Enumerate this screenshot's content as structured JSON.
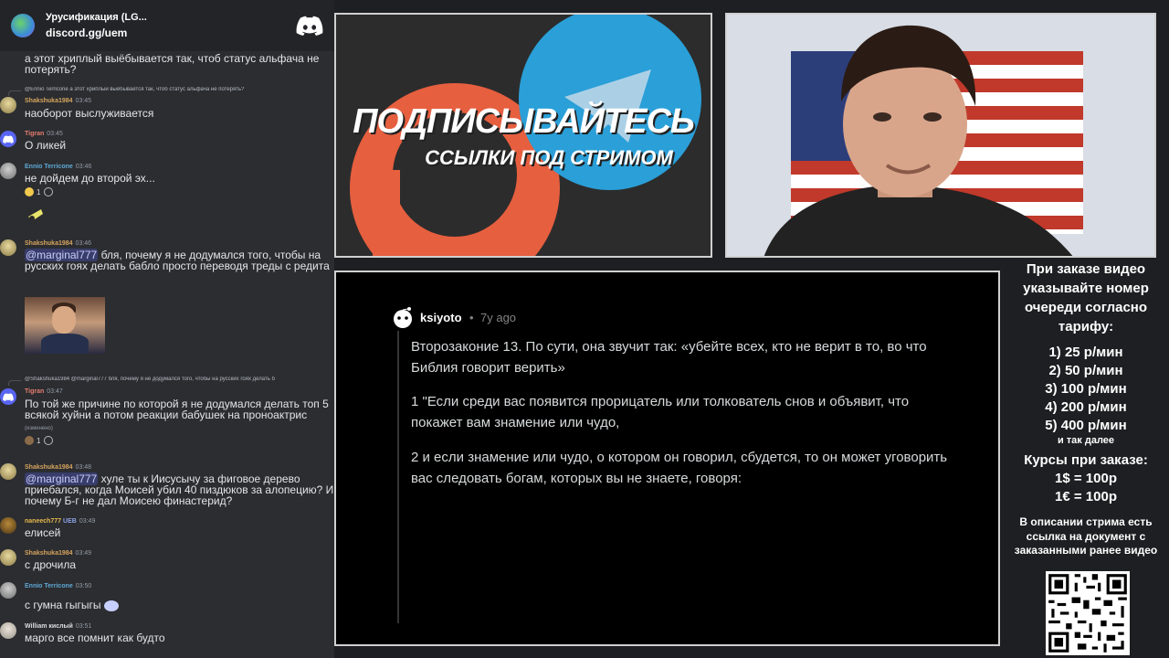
{
  "header": {
    "server_name": "Урусификация (LG...",
    "server_link": "discord.gg/uem"
  },
  "chat": {
    "top_text": "а этот хриплый выёбывается так, чтоб статус альфача не потерять?",
    "messages": [
      {
        "reply": "@Ennio Terricone  а этот хриплый выёбывается так, чтоб статус альфача не потерять?",
        "user": "Shakshuka1984",
        "time": "03:45",
        "text": "наоборот выслуживается"
      },
      {
        "user": "Tigran",
        "time": "03:45",
        "text": "О ликей"
      },
      {
        "user": "Ennio Terricone",
        "time": "03:46",
        "text": "не дойдем до второй эх...",
        "react_count": "1"
      },
      {
        "user": "Shakshuka1984",
        "time": "03:46",
        "mention": "@marginal777",
        "text": " бля, почему я не додумался того, чтобы на русских гоях делать бабло просто переводя треды с редита"
      },
      {
        "reply": "@Shakshuka1984  @marginal777  бля, почему я не додумался того, чтобы на русских гоях делать б",
        "user": "Tigran",
        "time": "03:47",
        "text": "По той же причине по которой я не додумался делать топ 5 всякой хуйни а потом  реакции бабушек на проноактрис",
        "edited": "(изменено)",
        "react_count": "1"
      },
      {
        "user": "Shakshuka1984",
        "time": "03:48",
        "mention": "@marginal777",
        "text": " хуле ты к Иисусычу за фиговое дерево приебался, когда Моисей убил 40 пиздюков за алопецию? И почему Б-г не дал Моисею финастерид?"
      },
      {
        "user": "naneech777",
        "tag": "UEB",
        "time": "03:49",
        "text": "елисей"
      },
      {
        "user": "Shakshuka1984",
        "time": "03:49",
        "text": "с дрочила"
      },
      {
        "user": "Ennio Terricone",
        "time": "03:50",
        "text": "с гумна гыгыгы"
      },
      {
        "user": "William кислый",
        "time": "03:51",
        "text": "марго все помнит как будто"
      }
    ]
  },
  "banner": {
    "line1": "ПОДПИСЫВАЙТЕСЬ",
    "line2": "ССЫЛКИ ПОД СТРИМОМ"
  },
  "reddit": {
    "username": "ksiyoto",
    "dot": "•",
    "time": "7y ago",
    "paragraphs": [
      "Второзаконие 13. По сути, она звучит так: «убейте всех, кто не верит в то, во что Библия говорит верить»",
      "1 \"Если среди вас появится прорицатель или толкователь снов и объявит, что покажет вам знамение или чудо,",
      "2 и если знамение или чудо, о котором он говорил, сбудется, то он может уговорить вас следовать богам, которых вы не знаете, говоря:"
    ]
  },
  "info": {
    "head": "При заказе видео указывайте номер очереди согласно тарифу:",
    "tariffs": [
      "1) 25 р/мин",
      "2) 50 р/мин",
      "3) 100 р/мин",
      "4) 200 р/мин",
      "5) 400 р/мин"
    ],
    "tariffs_more": "и так далее",
    "rates_head": "Курсы при заказе:",
    "rates": [
      "1$ = 100р",
      "1€ = 100р"
    ],
    "desc": "В описании стрима есть ссылка на документ с заказанными ранее видео"
  },
  "colors": {
    "shakshuka": "#d6a45d",
    "tigran": "#e67e6e",
    "ennio": "#5fa8d3",
    "naneech": "#e6b84a",
    "william": "#dcddde",
    "reddit_bg": "#000000"
  }
}
